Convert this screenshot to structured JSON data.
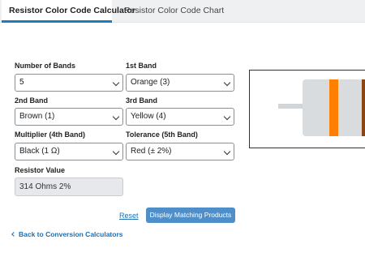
{
  "tabs": [
    {
      "label": "Resistor Color Code Calculator",
      "active": true
    },
    {
      "label": "Resistor Color Code Chart",
      "active": false
    }
  ],
  "form": {
    "bands": {
      "label": "Number of Bands",
      "value": "5"
    },
    "band1": {
      "label": "1st Band",
      "value": "Orange (3)"
    },
    "band2": {
      "label": "2nd Band",
      "value": "Brown (1)"
    },
    "band3": {
      "label": "3rd Band",
      "value": "Yellow (4)"
    },
    "multiplier": {
      "label": "Multiplier (4th Band)",
      "value": "Black (1 Ω)"
    },
    "tolerance": {
      "label": "Tolerance (5th Band)",
      "value": "Red (± 2%)"
    },
    "result": {
      "label": "Resistor Value",
      "value": "314 Ohms 2%"
    }
  },
  "actions": {
    "reset": "Reset",
    "display": "Display Matching Products",
    "back": "Back to Conversion Calculators"
  },
  "preview": {
    "band_colors": [
      "#ff8000",
      "#8b4513"
    ]
  },
  "colors": {
    "accent": "#1a7fc1",
    "link": "#1a6fb5",
    "button": "#4f8fc9"
  }
}
